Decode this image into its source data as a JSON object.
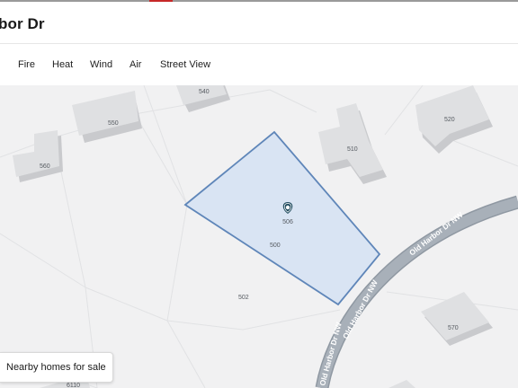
{
  "header": {
    "title": "bor Dr"
  },
  "tabs": [
    {
      "label": "Fire"
    },
    {
      "label": "Heat"
    },
    {
      "label": "Wind"
    },
    {
      "label": "Air"
    },
    {
      "label": "Street View"
    }
  ],
  "map": {
    "street_label": "Old Harbor Dr NW",
    "parcel_labels": {
      "selected": "500",
      "pin": "506"
    },
    "building_numbers": [
      "540",
      "550",
      "560",
      "510",
      "520",
      "502",
      "570",
      "6110"
    ]
  },
  "nearby_button": {
    "label": "Nearby homes for sale"
  },
  "colors": {
    "map_background": "#f1f1f2",
    "parcel_fill": "#d9e4f3",
    "parcel_stroke": "#5f86b9",
    "road": "#a5adb6",
    "pin": "#214c5f"
  }
}
